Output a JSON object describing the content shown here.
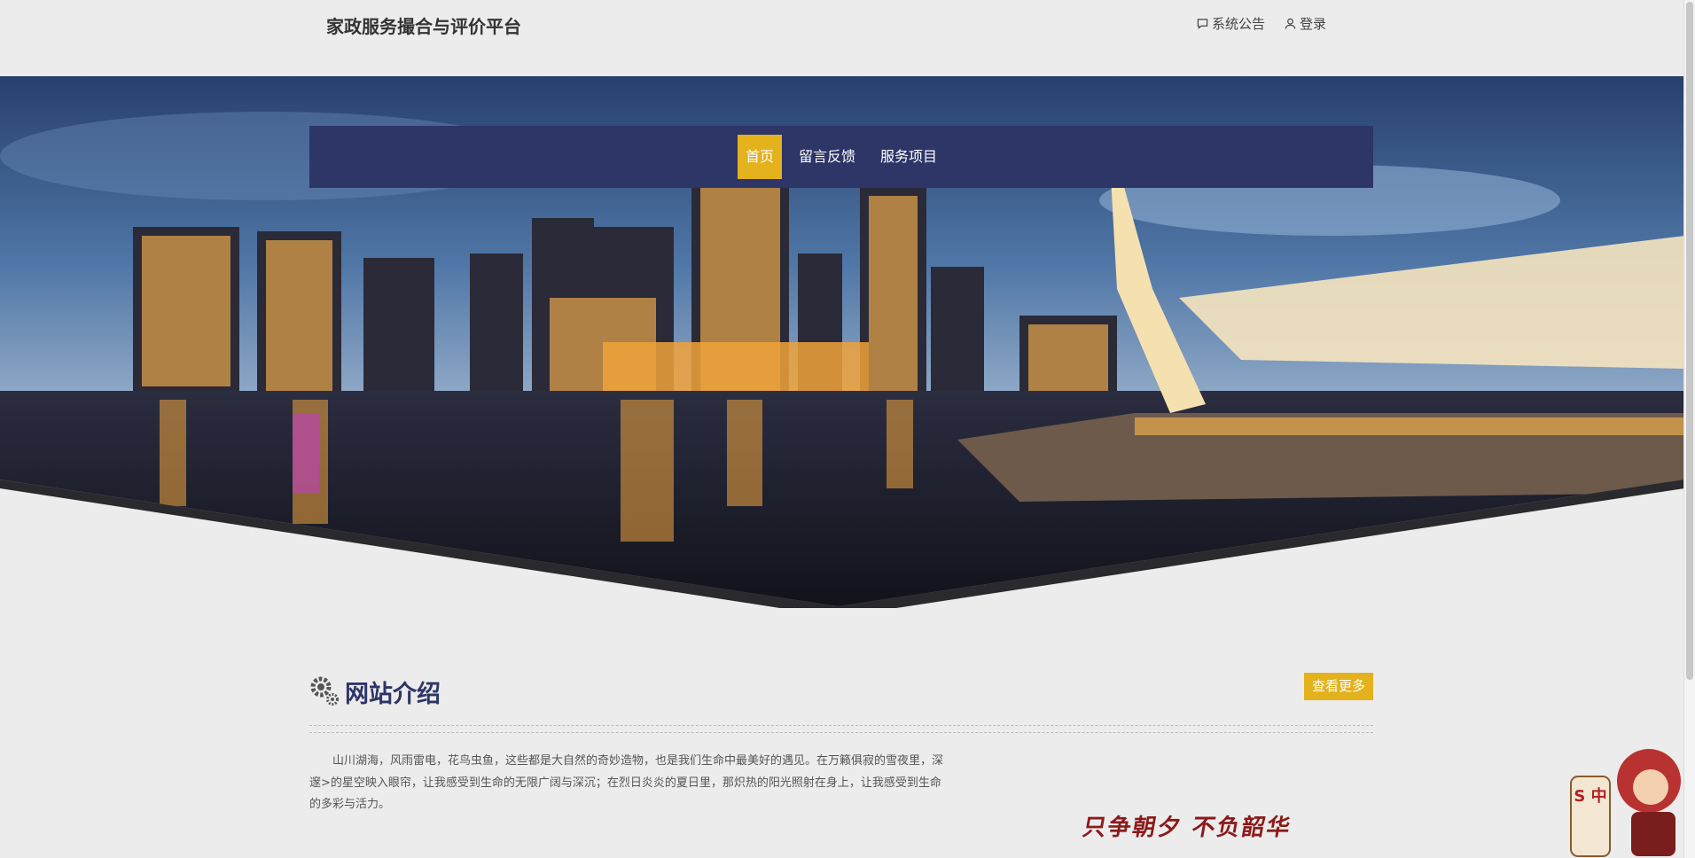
{
  "header": {
    "site_title": "家政服务撮合与评价平台",
    "links": [
      {
        "label": "系统公告",
        "icon": "message-square-icon"
      },
      {
        "label": "登录",
        "icon": "user-icon"
      }
    ]
  },
  "nav": {
    "items": [
      {
        "label": "首页",
        "active": true
      },
      {
        "label": "留言反馈",
        "active": false
      },
      {
        "label": "服务项目",
        "active": false
      }
    ],
    "accent": "#e3b21c",
    "bar_color": "#2e3567"
  },
  "hero": {
    "image": "city-skyline-night-banner"
  },
  "about": {
    "title": "网站介绍",
    "more_label": "查看更多",
    "text": "山川湖海，风雨雷电，花鸟虫鱼，这些都是大自然的奇妙造物，也是我们生命中最美好的遇见。在万籁俱寂的雪夜里，深邃>的星空映入眼帘，让我感受到生命的无限广阔与深沉；在烈日炎炎的夏日里，那炽热的阳光照射在身上，让我感受到生命的多彩与活力。"
  },
  "decor": {
    "brush_text": "只争朝夕 不负韶华",
    "mascot_badge": "S 中"
  }
}
